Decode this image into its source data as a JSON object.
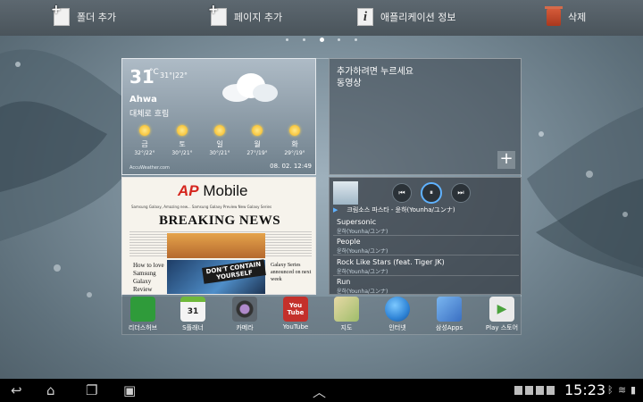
{
  "topbar": {
    "add_folder": "폴더 추가",
    "add_page": "페이지 추가",
    "app_info": "애플리케이션 정보",
    "delete": "삭제"
  },
  "pager": {
    "count": 5,
    "active_index": 3
  },
  "weather": {
    "temp": "31",
    "unit": "°C",
    "range": "31°|22°",
    "city": "Ahwa",
    "condition": "대체로 흐림",
    "forecast": [
      {
        "day": "금",
        "temps": "32°/22°"
      },
      {
        "day": "토",
        "temps": "30°/21°"
      },
      {
        "day": "일",
        "temps": "30°/21°"
      },
      {
        "day": "월",
        "temps": "27°/19°"
      },
      {
        "day": "화",
        "temps": "29°/19°"
      }
    ],
    "source": "AccuWeather.com",
    "updated": "08. 02. 12:49"
  },
  "video_widget": {
    "line1": "추가하려면 누르세요",
    "line2": "동영상"
  },
  "news": {
    "logo_ap": "AP",
    "logo_text": "Mobile",
    "tagline": "Samsung Galaxy, Amazing new...   Samsung Galaxy Preview   New Galaxy Series",
    "headline": "BREAKING NEWS",
    "story_left": "How to love Samsung Galaxy Review",
    "story_right": "Galaxy Series announced on next week",
    "image_caption": "DON'T CONTAIN YOURSELF"
  },
  "music": {
    "now_playing": "크림소스 파스타 - 윤하(Younha/ユンナ)",
    "songs": [
      {
        "title": "Supersonic",
        "artist": "윤하(Younha/ユンナ)"
      },
      {
        "title": "People",
        "artist": "윤하(Younha/ユンナ)"
      },
      {
        "title": "Rock Like Stars (feat. Tiger JK)",
        "artist": "윤하(Younha/ユンナ)"
      },
      {
        "title": "Run",
        "artist": "윤하(Younha/ユンナ)"
      }
    ]
  },
  "dock": [
    {
      "label": "리더스허브",
      "icon": "readers-hub-icon",
      "glyph": "",
      "color": "#2f9b3a"
    },
    {
      "label": "S플래너",
      "icon": "calendar-icon",
      "glyph": "31",
      "color": "#f4f4f4"
    },
    {
      "label": "카메라",
      "icon": "camera-icon",
      "glyph": "",
      "color": "#5d666e"
    },
    {
      "label": "YouTube",
      "icon": "youtube-icon",
      "glyph": "You Tube",
      "color": "#c4302b"
    },
    {
      "label": "지도",
      "icon": "maps-icon",
      "glyph": "",
      "color": "#cdbb7f"
    },
    {
      "label": "인터넷",
      "icon": "internet-globe-icon",
      "glyph": "",
      "color": "#2f84d6"
    },
    {
      "label": "삼성Apps",
      "icon": "samsung-apps-icon",
      "glyph": "",
      "color": "#3a6fc2"
    },
    {
      "label": "Play 스토어",
      "icon": "play-store-icon",
      "glyph": "▶",
      "color": "#eaeaea"
    }
  ],
  "status": {
    "time": "15:23"
  }
}
